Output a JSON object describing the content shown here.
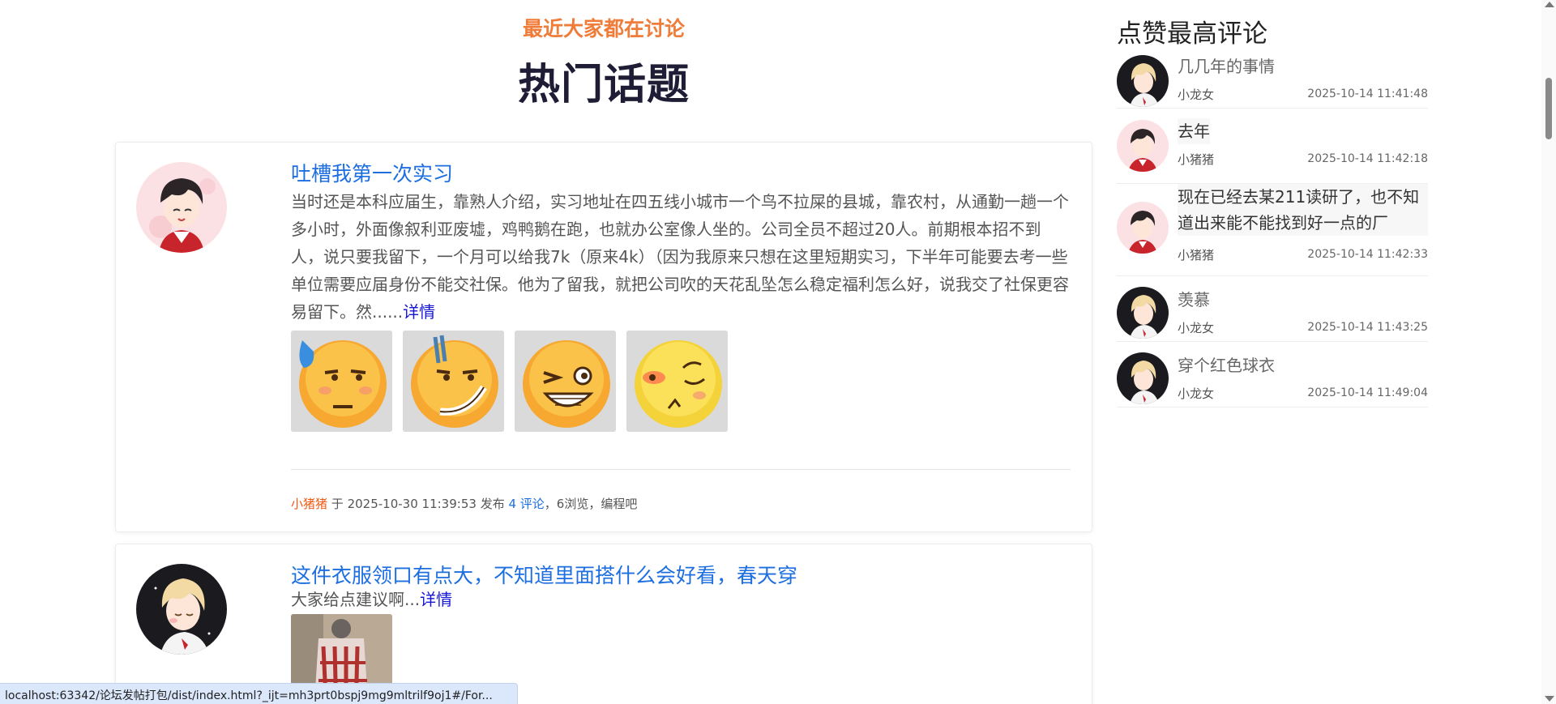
{
  "header": {
    "subtitle": "最近大家都在讨论",
    "title": "热门话题"
  },
  "posts": [
    {
      "title": "吐槽我第一次实习",
      "excerpt": "当时还是本科应届生，靠熟人介绍，实习地址在四五线小城市一个鸟不拉屎的县城，靠农村，从通勤一趟一个多小时，外面像叙利亚废墟，鸡鸭鹅在跑，也就办公室像人坐的。公司全员不超过20人。前期根本招不到人，说只要我留下，一个月可以给我7k（原来4k）（因为我原来只想在这里短期实习，下半年可能要去考一些单位需要应届身份不能交社保。他为了留我，就把公司吹的天花乱坠怎么稳定福利怎么好，说我交了社保更容易留下。然......",
      "detail_link": "详情",
      "images": [
        "emoji-sweat",
        "emoji-smirk-sweat",
        "emoji-wink-grin",
        "emoji-shy"
      ],
      "author": "小猪猪",
      "meta_at": "于",
      "date": "2025-10-30 11:39:53",
      "meta_published": "发布",
      "comments": "4 评论",
      "meta_rest": "，6浏览，编程吧"
    },
    {
      "title": "这件衣服领口有点大，不知道里面搭什么会好看，春天穿",
      "excerpt": "大家给点建议啊...",
      "detail_link": "详情",
      "images": [
        "photo-clothes"
      ]
    }
  ],
  "sidebar": {
    "title": "点赞最高评论",
    "comments": [
      {
        "text": "几几年的事情",
        "user": "小龙女",
        "time": "2025-10-14 11:41:48",
        "avatar": "blond-boy"
      },
      {
        "text": "去年",
        "user": "小猪猪",
        "time": "2025-10-14 11:42:18",
        "avatar": "dark-hair-boy"
      },
      {
        "text": "现在已经去某211读研了，也不知道出来能不能找到好一点的厂",
        "user": "小猪猪",
        "time": "2025-10-14 11:42:33",
        "avatar": "dark-hair-boy"
      },
      {
        "text": "羡慕",
        "user": "小龙女",
        "time": "2025-10-14 11:43:25",
        "avatar": "blond-boy"
      },
      {
        "text": "穿个红色球衣",
        "user": "小龙女",
        "time": "2025-10-14 11:49:04",
        "avatar": "blond-boy"
      }
    ]
  },
  "status_bar": {
    "url": "localhost:63342/论坛发帖打包/dist/index.html?_ijt=mh3prt0bspj9mg9mltrilf9oj1#/For..."
  },
  "colors": {
    "accent_orange": "#f07c3a",
    "title_dark": "#1f1d36",
    "link_blue": "#1d6fe0",
    "detail_blue": "#1515d6",
    "author_orange": "#f05a14"
  }
}
